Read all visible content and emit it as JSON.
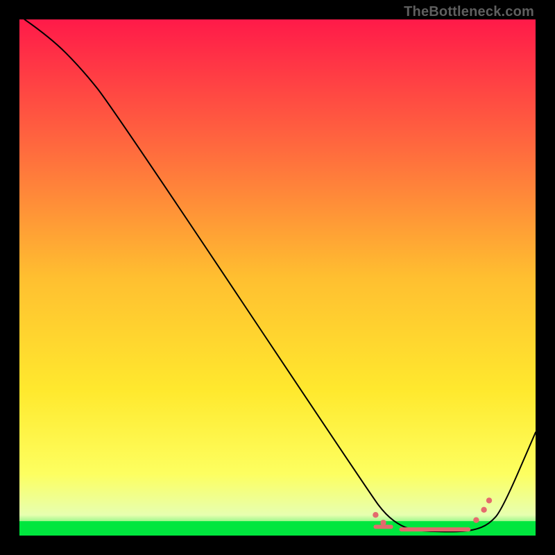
{
  "watermark": "TheBottleneck.com",
  "chart_data": {
    "type": "line",
    "title": "",
    "xlabel": "",
    "ylabel": "",
    "xlim": [
      0,
      100
    ],
    "ylim": [
      0,
      100
    ],
    "gradient_stops": [
      {
        "offset": 0,
        "color": "#ff1a49"
      },
      {
        "offset": 25,
        "color": "#ff6a3e"
      },
      {
        "offset": 50,
        "color": "#ffbf30"
      },
      {
        "offset": 72,
        "color": "#ffe92e"
      },
      {
        "offset": 88,
        "color": "#fdff60"
      },
      {
        "offset": 96,
        "color": "#e7ffb0"
      },
      {
        "offset": 100,
        "color": "#00e63e"
      }
    ],
    "green_band_top_pct": 97.2,
    "series": [
      {
        "name": "bottleneck-curve",
        "points": [
          {
            "x": 1.0,
            "y": 100.0
          },
          {
            "x": 6.0,
            "y": 96.5
          },
          {
            "x": 12.0,
            "y": 90.5
          },
          {
            "x": 18.0,
            "y": 83.0
          },
          {
            "x": 68.0,
            "y": 8.0
          },
          {
            "x": 71.0,
            "y": 4.0
          },
          {
            "x": 74.0,
            "y": 1.8
          },
          {
            "x": 77.0,
            "y": 0.9
          },
          {
            "x": 84.0,
            "y": 0.7
          },
          {
            "x": 88.0,
            "y": 1.0
          },
          {
            "x": 91.0,
            "y": 2.2
          },
          {
            "x": 93.5,
            "y": 5.0
          },
          {
            "x": 100.0,
            "y": 20.0
          }
        ]
      }
    ],
    "marker_bars": [
      {
        "x0": 69.0,
        "x1": 72.0,
        "y": 1.7
      },
      {
        "x0": 74.0,
        "x1": 87.0,
        "y": 1.2
      }
    ],
    "marker_dots": [
      {
        "x": 69.0,
        "y": 4.0
      },
      {
        "x": 70.5,
        "y": 2.5
      },
      {
        "x": 88.5,
        "y": 3.0
      },
      {
        "x": 90.0,
        "y": 5.0
      },
      {
        "x": 91.0,
        "y": 6.8
      }
    ]
  }
}
